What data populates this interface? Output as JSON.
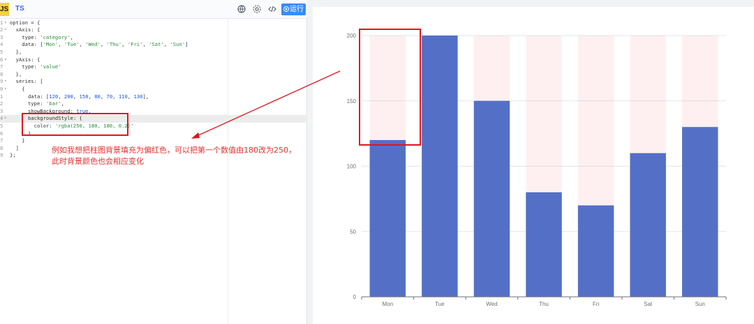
{
  "editor": {
    "tabs": [
      {
        "label": "JS"
      },
      {
        "label": "TS"
      }
    ],
    "toolbar": {
      "icons": [
        "globe-icon",
        "settings-icon",
        "code-icon"
      ],
      "run_label": "运行"
    },
    "code_lines": [
      {
        "num": "1",
        "fold": true,
        "text": "option = {"
      },
      {
        "num": "2",
        "fold": true,
        "text": "  xAxis: {"
      },
      {
        "num": "3",
        "fold": false,
        "text": "    type: 'category',"
      },
      {
        "num": "4",
        "fold": false,
        "text": "    data: ['Mon', 'Tue', 'Wed', 'Thu', 'Fri', 'Sat', 'Sun']"
      },
      {
        "num": "5",
        "fold": false,
        "text": "  },"
      },
      {
        "num": "6",
        "fold": true,
        "text": "  yAxis: {"
      },
      {
        "num": "7",
        "fold": false,
        "text": "    type: 'value'"
      },
      {
        "num": "8",
        "fold": false,
        "text": "  },"
      },
      {
        "num": "9",
        "fold": true,
        "text": "  series: ["
      },
      {
        "num": "0",
        "fold": true,
        "text": "    {"
      },
      {
        "num": "1",
        "fold": false,
        "text": "      data: [120, 200, 150, 80, 70, 110, 130],"
      },
      {
        "num": "2",
        "fold": false,
        "text": "      type: 'bar',"
      },
      {
        "num": "3",
        "fold": false,
        "text": "      showBackground: true,"
      },
      {
        "num": "4",
        "fold": true,
        "text": "      backgroundStyle: {"
      },
      {
        "num": "5",
        "fold": false,
        "text": "        color: 'rgba(250, 180, 180, 0.2)'"
      },
      {
        "num": "6",
        "fold": false,
        "text": "      }"
      },
      {
        "num": "7",
        "fold": false,
        "text": "    }"
      },
      {
        "num": "8",
        "fold": false,
        "text": "  ]"
      },
      {
        "num": "9",
        "fold": false,
        "text": "};"
      }
    ],
    "active_line": 13,
    "annotation": {
      "line1": "例如我想把柱图背景填充为偏红色，可以把第一个数值由180改为250，",
      "line2": "此时背景颜色也会相应变化"
    }
  },
  "colors": {
    "bar": "#5470c6",
    "bar_background": "rgba(250, 180, 180, 0.2)",
    "annotation_red": "#e0141e",
    "run_button": "#3a8bf5"
  },
  "chart_data": {
    "type": "bar",
    "categories": [
      "Mon",
      "Tue",
      "Wed",
      "Thu",
      "Fri",
      "Sat",
      "Sun"
    ],
    "values": [
      120,
      200,
      150,
      80,
      70,
      110,
      130
    ],
    "ylim": [
      0,
      200
    ],
    "yticks": [
      0,
      50,
      100,
      150,
      200
    ],
    "show_background": true,
    "grid": true,
    "title": "",
    "xlabel": "",
    "ylabel": ""
  }
}
